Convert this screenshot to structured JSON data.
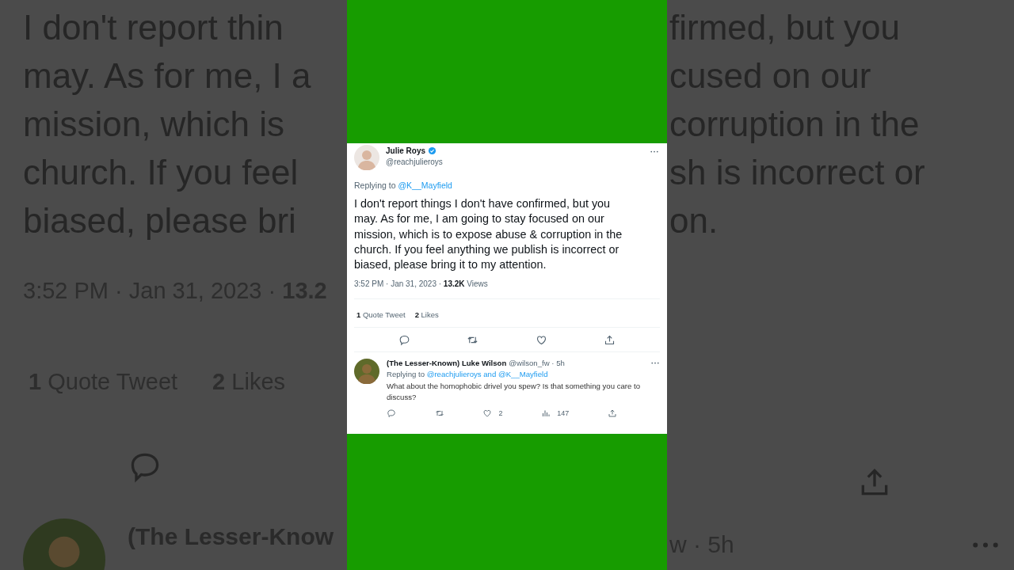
{
  "background": {
    "left_lines": [
      "I don't report thin",
      "may. As for me, I a",
      "mission, which is",
      "church. If you feel",
      "biased, please bri"
    ],
    "right_lines": [
      "firmed, but you",
      "cused on our",
      "corruption in the",
      "sh is incorrect or",
      "on."
    ],
    "timestamp": "3:52 PM · Jan 31, 2023 · **13.2**",
    "quote_tweets": "**1** Quote Tweet",
    "likes": "**2** Likes",
    "reply_name": "(The Lesser-Know",
    "reply_time": "w · 5h"
  },
  "tweet": {
    "name": "Julie Roys",
    "verified": true,
    "handle": "@reachjulieroys",
    "replying_label": "Replying to",
    "replying_to": "@K__Mayfield",
    "text": "I don't report things I don't have confirmed, but you\nmay. As for me, I am going to stay focused on our\nmission, which is to expose abuse & corruption in the\nchurch. If you feel anything we publish is incorrect or\nbiased, please bring it to my attention.",
    "meta": "3:52 PM · Jan 31, 2023 · **13.2K** Views",
    "quote_tweets": "**1** Quote Tweet",
    "likes": "**2** Likes"
  },
  "reply": {
    "name": "(The Lesser-Known) Luke Wilson",
    "handle": "@wilson_fw · 5h",
    "replying_label": "Replying to",
    "replying_to": "@reachjulieroys and @K__Mayfield",
    "text": "What about the homophobic drivel you spew? Is that something you care to discuss?",
    "like_count": "2",
    "view_count": "147"
  }
}
